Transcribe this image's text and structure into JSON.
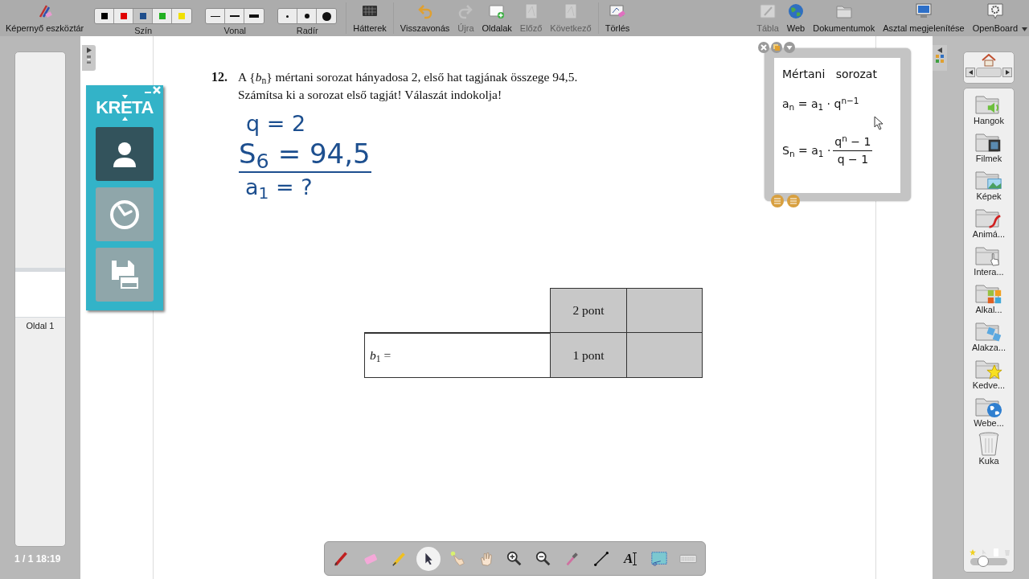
{
  "toolbar": {
    "left": [
      {
        "kind": "button",
        "label": "Képernyő eszköztár",
        "disabled": false
      },
      {
        "kind": "swatches",
        "label": "Szín",
        "swatches": [
          {
            "color": "#000000",
            "selected": false
          },
          {
            "color": "#e00000",
            "selected": false
          },
          {
            "color": "#1f4e8c",
            "selected": true
          },
          {
            "color": "#22b022",
            "selected": false
          },
          {
            "color": "#f0e000",
            "selected": false
          }
        ]
      },
      {
        "kind": "line_widths",
        "label": "Vonal"
      },
      {
        "kind": "eraser_sizes",
        "label": "Radír"
      },
      {
        "kind": "separator"
      },
      {
        "kind": "button",
        "label": "Hátterek",
        "disabled": false
      },
      {
        "kind": "separator"
      },
      {
        "kind": "button",
        "label": "Visszavonás",
        "disabled": false
      },
      {
        "kind": "button",
        "label": "Újra",
        "disabled": true
      },
      {
        "kind": "button",
        "label": "Oldalak",
        "disabled": false
      },
      {
        "kind": "button",
        "label": "Előző",
        "disabled": true
      },
      {
        "kind": "button",
        "label": "Következő",
        "disabled": true
      },
      {
        "kind": "separator"
      },
      {
        "kind": "button",
        "label": "Törlés",
        "disabled": false
      }
    ],
    "right": [
      {
        "kind": "button",
        "label": "Tábla",
        "disabled": true
      },
      {
        "kind": "button",
        "label": "Web",
        "disabled": false
      },
      {
        "kind": "button",
        "label": "Dokumentumok",
        "disabled": false
      },
      {
        "kind": "button",
        "label": "Asztal megjelenítése",
        "disabled": false
      },
      {
        "kind": "button",
        "label": "OpenBoard",
        "disabled": false,
        "menu": true
      }
    ]
  },
  "pages_panel": {
    "pages": [
      {
        "label": "Oldal 1"
      }
    ],
    "status": "1 / 1 18:19"
  },
  "kreta": {
    "logo": "KRETA",
    "buttons": [
      {
        "selected": true
      },
      {
        "selected": false
      },
      {
        "selected": false
      }
    ]
  },
  "document": {
    "number": "12.",
    "question": [
      "A {*b*$_{n}$} mértani sorozat hányadosa 2, első hat tagjának összege 94,5.",
      "Számítsa ki a sorozat első tagját! Válaszát indokolja!"
    ],
    "handwriting": [
      "q = 2",
      "S$_{6}$ = 94,5",
      "a$_{1}$ = ?"
    ],
    "score_table": [
      {
        "points": "2 pont"
      },
      {
        "label": "*b*$_{1}$ =",
        "points": "1 pont"
      }
    ]
  },
  "formula_widget": {
    "title": "Mértani   sorozat",
    "formula_1": "a$_{n}$ = a$_{1}$ · q$^{n−1}$",
    "formula_2": {
      "lhs": "S$_{n}$ = a$_{1}$ ·",
      "numerator": "q$^{n}$ − 1",
      "denominator": "q − 1"
    }
  },
  "library": {
    "items": [
      {
        "kind": "folder",
        "label": "Hangok"
      },
      {
        "kind": "folder",
        "label": "Filmek"
      },
      {
        "kind": "folder",
        "label": "Képek"
      },
      {
        "kind": "folder",
        "label": "Animá..."
      },
      {
        "kind": "folder",
        "label": "Intera..."
      },
      {
        "kind": "folder",
        "label": "Alkal..."
      },
      {
        "kind": "folder",
        "label": "Alakza..."
      },
      {
        "kind": "folder",
        "label": "Kedve..."
      },
      {
        "kind": "folder",
        "label": "Webe..."
      },
      {
        "kind": "trash",
        "label": "Kuka"
      }
    ],
    "zoom": {
      "level": 0.35
    }
  },
  "tools": [
    {
      "selected": false
    },
    {
      "selected": false
    },
    {
      "selected": false
    },
    {
      "selected": true
    },
    {
      "selected": false
    },
    {
      "selected": false
    },
    {
      "selected": false
    },
    {
      "selected": false
    },
    {
      "selected": false
    },
    {
      "selected": false
    },
    {
      "selected": false,
      "glyph": "A"
    },
    {
      "selected": false
    },
    {
      "selected": false
    }
  ]
}
